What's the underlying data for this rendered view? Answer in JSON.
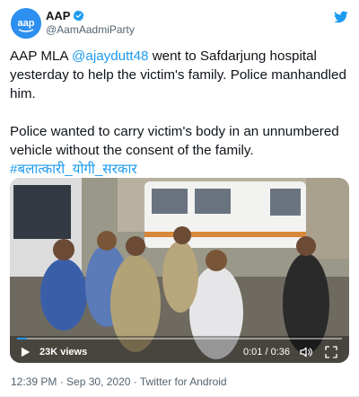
{
  "account": {
    "avatar_text": "aap",
    "name": "AAP",
    "handle": "@AamAadmiParty"
  },
  "tweet": {
    "line1_prefix": "AAP MLA ",
    "mention": "@ajaydutt48",
    "line1_suffix": " went to Safdarjung hospital yesterday to help the victim's family. Police manhandled him.",
    "line2_text": "Police wanted to carry victim's body in an unnumbered vehicle without the consent of the family. ",
    "hashtag": "#बलात्कारी_योगी_सरकार"
  },
  "video": {
    "views_label": "23K views",
    "time_label": "0:01 / 0:36",
    "progress": 0.03,
    "icons": [
      "play-icon",
      "volume-icon",
      "fullscreen-icon"
    ]
  },
  "meta": {
    "timestamp": "12:39 PM · Sep 30, 2020 · Twitter for Android"
  },
  "colors": {
    "accent": "#1d9bf0",
    "avatar": "#2d8ff0",
    "secondary_text": "#536471"
  }
}
